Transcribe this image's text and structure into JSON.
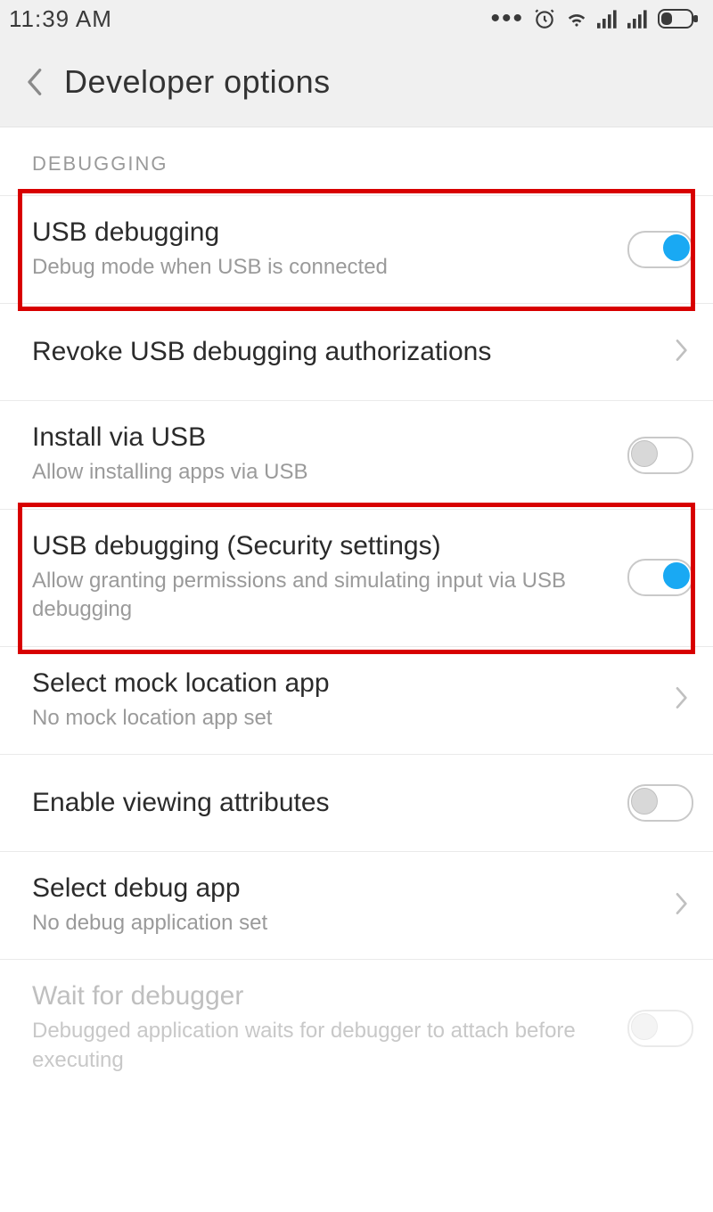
{
  "statusbar": {
    "time": "11:39 AM"
  },
  "header": {
    "title": "Developer options"
  },
  "section": {
    "label": "DEBUGGING"
  },
  "items": {
    "usb_debugging": {
      "title": "USB debugging",
      "subtitle": "Debug mode when USB is connected",
      "toggle": "on"
    },
    "revoke": {
      "title": "Revoke USB debugging authorizations"
    },
    "install_via_usb": {
      "title": "Install via USB",
      "subtitle": "Allow installing apps via USB",
      "toggle": "off"
    },
    "usb_debugging_security": {
      "title": "USB debugging (Security settings)",
      "subtitle": "Allow granting permissions and simulating input via USB debugging",
      "toggle": "on"
    },
    "mock_location": {
      "title": "Select mock location app",
      "subtitle": "No mock location app set"
    },
    "viewing_attributes": {
      "title": "Enable viewing attributes",
      "toggle": "off"
    },
    "select_debug_app": {
      "title": "Select debug app",
      "subtitle": "No debug application set"
    },
    "wait_debugger": {
      "title": "Wait for debugger",
      "subtitle": "Debugged application waits for debugger to attach before executing",
      "toggle": "off",
      "disabled": true
    }
  },
  "highlights": [
    "usb_debugging",
    "usb_debugging_security"
  ],
  "colors": {
    "highlight_border": "#d80000",
    "toggle_on": "#19a9f3"
  }
}
